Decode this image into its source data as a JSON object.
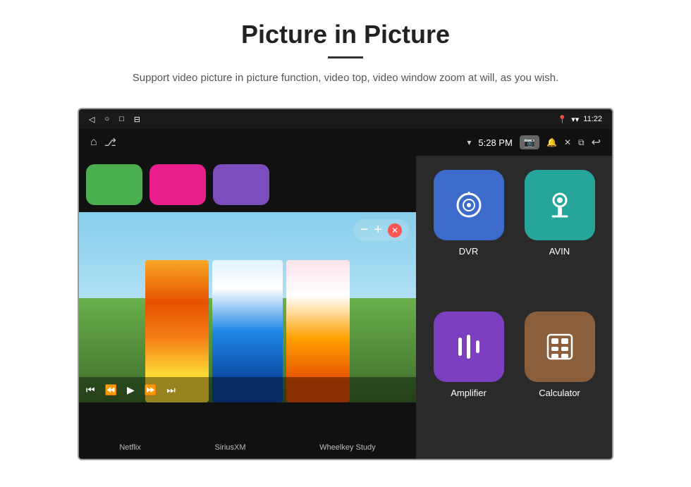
{
  "header": {
    "title": "Picture in Picture",
    "divider": true,
    "subtitle": "Support video picture in picture function, video top, video window zoom at will, as you wish."
  },
  "status_bar": {
    "time": "11:22",
    "wifi": "▼▲",
    "location": "📍"
  },
  "nav_bar": {
    "time": "5:28 PM",
    "back_label": "◁",
    "home_label": "○",
    "recents_label": "□",
    "menu_label": "⊟"
  },
  "pip_controls": {
    "minus": "−",
    "plus": "+",
    "close": "✕"
  },
  "apps_top": [
    {
      "id": "netflix",
      "color": "green",
      "label": "Netflix"
    },
    {
      "id": "siriusxm",
      "color": "pink",
      "label": "SiriusXM"
    },
    {
      "id": "wheelkey",
      "color": "purple",
      "label": "Wheelkey Study"
    }
  ],
  "apps_right": [
    {
      "id": "dvr",
      "label": "DVR",
      "color": "blue",
      "icon": "wifi_circle"
    },
    {
      "id": "avin",
      "label": "AVIN",
      "color": "teal",
      "icon": "plug"
    },
    {
      "id": "amplifier",
      "label": "Amplifier",
      "color": "purple",
      "icon": "equalizer"
    },
    {
      "id": "calculator",
      "label": "Calculator",
      "color": "brown",
      "icon": "grid"
    }
  ],
  "bottom_labels": [
    "Netflix",
    "SiriusXM",
    "Wheelkey Study",
    "Amplifier",
    "Calculator"
  ]
}
